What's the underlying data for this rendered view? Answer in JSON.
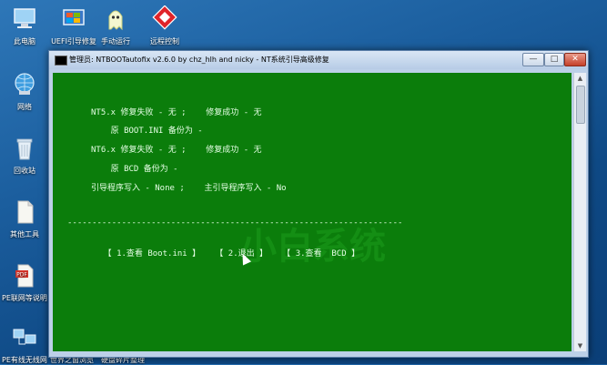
{
  "desktop": {
    "icons": [
      {
        "label": "此电脑"
      },
      {
        "label": "UEFI引导修复"
      },
      {
        "label": "手动运行"
      },
      {
        "label": "远程控制"
      },
      {
        "label": "网络"
      },
      {
        "label": "回收站"
      },
      {
        "label": "其他工具"
      },
      {
        "label": "PE联网等说明"
      },
      {
        "label": "PE有线无线网"
      },
      {
        "label": "世界之窗浏览"
      },
      {
        "label": "硬盘碎片整理"
      }
    ]
  },
  "window": {
    "title": "管理员: NTBOOTautofix v2.6.0 by chz_hlh and nicky - NT系统引导高级修复",
    "minimize": "—",
    "maximize": "□",
    "close": "✕"
  },
  "console": {
    "lines": [
      "NT5.x 修复失败 - 无 ;    修复成功 - 无",
      "    原 BOOT.INI 备份为 -",
      "NT6.x 修复失败 - 无 ;    修复成功 - 无",
      "    原 BCD 备份为 -",
      "引导程序写入 - None ;    主引导程序写入 - No",
      "--------------------------------------------------------------------",
      "    【 1.查看 Boot.ini 】   【 2.退出 】   【 3.查看  BCD 】"
    ],
    "watermark": "小白系统"
  },
  "colors": {
    "console_bg": "#0b7d0b",
    "console_text": "#e6ffe6",
    "desktop_bg": "#1b5e9e"
  }
}
